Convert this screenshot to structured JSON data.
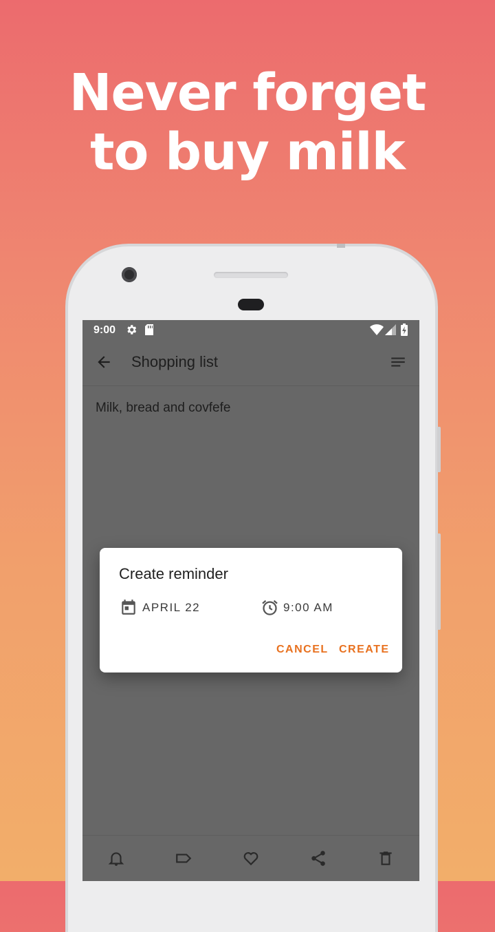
{
  "headline": {
    "line1": "Never forget",
    "line2": "to buy milk"
  },
  "statusbar": {
    "time": "9:00",
    "icons": [
      "gear-icon",
      "sd-card-icon",
      "wifi-icon",
      "signal-icon",
      "battery-charging-icon"
    ]
  },
  "toolbar": {
    "back_icon": "arrow-left-icon",
    "title": "Shopping list",
    "menu_icon": "sort-lines-icon"
  },
  "note": {
    "text": "Milk, bread and covfefe"
  },
  "dialog": {
    "title": "Create reminder",
    "date_icon": "calendar-icon",
    "date": "APRIL 22",
    "time_icon": "alarm-clock-icon",
    "time": "9:00 AM",
    "cancel_label": "CANCEL",
    "create_label": "CREATE"
  },
  "bottombar": {
    "icons": [
      "bell-icon",
      "label-tag-icon",
      "heart-icon",
      "share-icon",
      "trash-icon"
    ]
  },
  "colors": {
    "accent": "#e8711f",
    "screen_dim": "#676767",
    "background_top": "#ec6b6e",
    "background_bottom": "#f2ae6a"
  }
}
